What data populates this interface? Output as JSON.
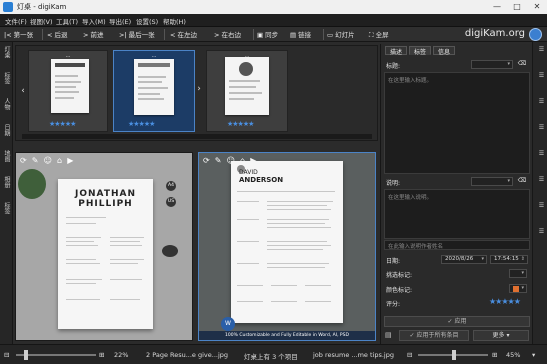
{
  "window": {
    "title": "灯桌 - digiKam",
    "min": "—",
    "max": "□",
    "close": "✕"
  },
  "menu": [
    "文件(F)",
    "视图(V)",
    "工具(T)",
    "导入(M)",
    "导出(E)",
    "设置(S)",
    "帮助(H)"
  ],
  "toolbar": {
    "first": "第一张",
    "back": "后退",
    "forward": "前进",
    "last": "最后一张",
    "left": "在左边",
    "right": "在右边",
    "sync": "同步",
    "link": "链接",
    "slideshow": "幻灯片",
    "fullscreen": "全屏",
    "brand": "digiKam.org"
  },
  "left_sidebar": [
    "灯桌",
    "标签",
    "人物",
    "日期",
    "地图",
    "相册",
    "标签"
  ],
  "filmstrip": {
    "items": [
      {
        "caption": "…",
        "name": "JONATHAN PHILLIPH",
        "selected": false,
        "rating": 5
      },
      {
        "caption": "…",
        "name": "",
        "selected": true,
        "rating": 5
      },
      {
        "caption": "…",
        "name": "",
        "selected": false,
        "rating": 5
      }
    ]
  },
  "preview_left": {
    "name_line1": "JONATHAN",
    "name_line2": "PHILLIPH",
    "badge1": "A4",
    "badge2": "US"
  },
  "preview_right": {
    "name_line1": "DAVID",
    "name_line2": "ANDERSON",
    "banner": "100% Customizable and Fully Editable in Word, AI, PSD"
  },
  "right_panel": {
    "tabs": [
      "描述",
      "标签",
      "信息"
    ],
    "title_label": "标题:",
    "title_placeholder": "在这里输入标题。",
    "caption_label": "说明:",
    "caption_placeholder": "在这里输入说明。",
    "author_placeholder": "在此输入说明作者姓名",
    "date_label": "日期:",
    "date_value": "2020/8/26",
    "time_value": "17:54:15",
    "pick_label": "挑选标记:",
    "color_label": "颜色标记:",
    "rating_label": "评分:",
    "rating": 5,
    "apply_label": "应用",
    "apply_all_label": "应用于所有条目",
    "more_label": "更多"
  },
  "statusbar": {
    "zoom_left": "22%",
    "file_left": "2 Page Resu...e give...jpg",
    "info": "灯桌上有 3 个项目",
    "file_right": "job resume ...me tips.jpg",
    "zoom_right": "45%"
  },
  "colors": {
    "accent": "#4a8fe0",
    "selection": "#1c3c66",
    "background": "#2b2b2b"
  }
}
